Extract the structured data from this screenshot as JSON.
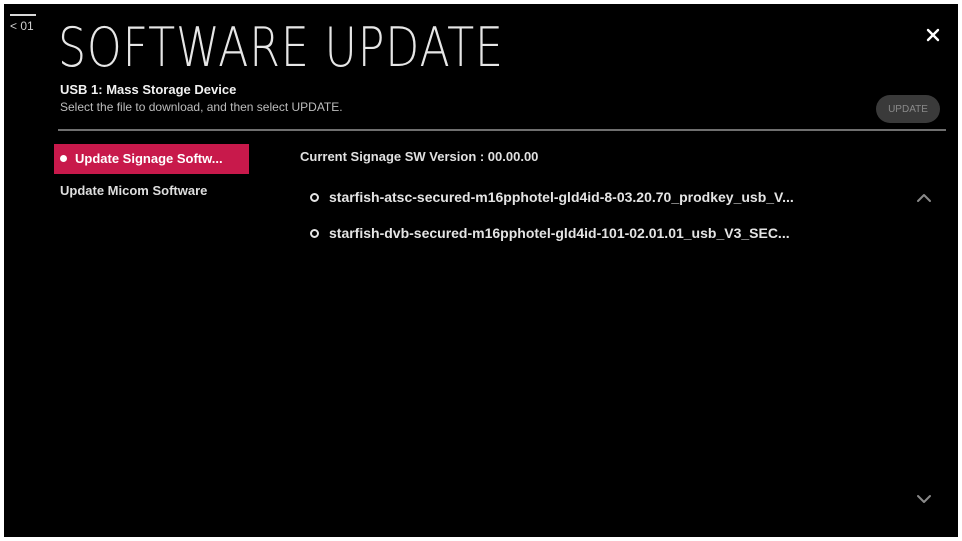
{
  "header": {
    "back_label": "< 01",
    "title": "SOFTWARE UPDATE",
    "device": "USB 1: Mass Storage Device",
    "instruction": "Select the file to download, and then select UPDATE.",
    "update_label": "UPDATE"
  },
  "sidebar": {
    "items": [
      {
        "label": "Update Signage Softw...",
        "active": true
      },
      {
        "label": "Update Micom Software",
        "active": false
      }
    ]
  },
  "main": {
    "version_label": "Current Signage SW Version :  00.00.00",
    "files": [
      {
        "name": "starfish-atsc-secured-m16pphotel-gld4id-8-03.20.70_prodkey_usb_V..."
      },
      {
        "name": "starfish-dvb-secured-m16pphotel-gld4id-101-02.01.01_usb_V3_SEC..."
      }
    ]
  },
  "icons": {
    "close": "close-icon",
    "scroll_up": "chevron-up-icon",
    "scroll_down": "chevron-down-icon"
  },
  "colors": {
    "accent": "#c8194b",
    "background": "#000000",
    "disabled_button": "#3a3a3a"
  }
}
